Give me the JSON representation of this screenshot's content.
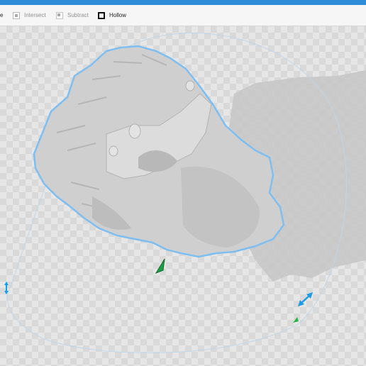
{
  "toolbar": {
    "partial_left_label": "e",
    "intersect_label": "Intersect",
    "subtract_label": "Subtract",
    "hollow_label": "Hollow"
  },
  "colors": {
    "title_bar": "#2f8bd8",
    "selection_outline": "#6fb6ef",
    "gizmo_blue": "#1e9be6",
    "gizmo_green": "#2bb34a",
    "model_gray": "#cfcfcf"
  },
  "icons": {
    "intersect": "intersect-icon",
    "subtract": "subtract-icon",
    "hollow": "hollow-icon",
    "scale_handle": "scale-arrow-icon",
    "rotate_handle": "rotate-handle-icon",
    "move_handle": "move-handle-icon"
  }
}
